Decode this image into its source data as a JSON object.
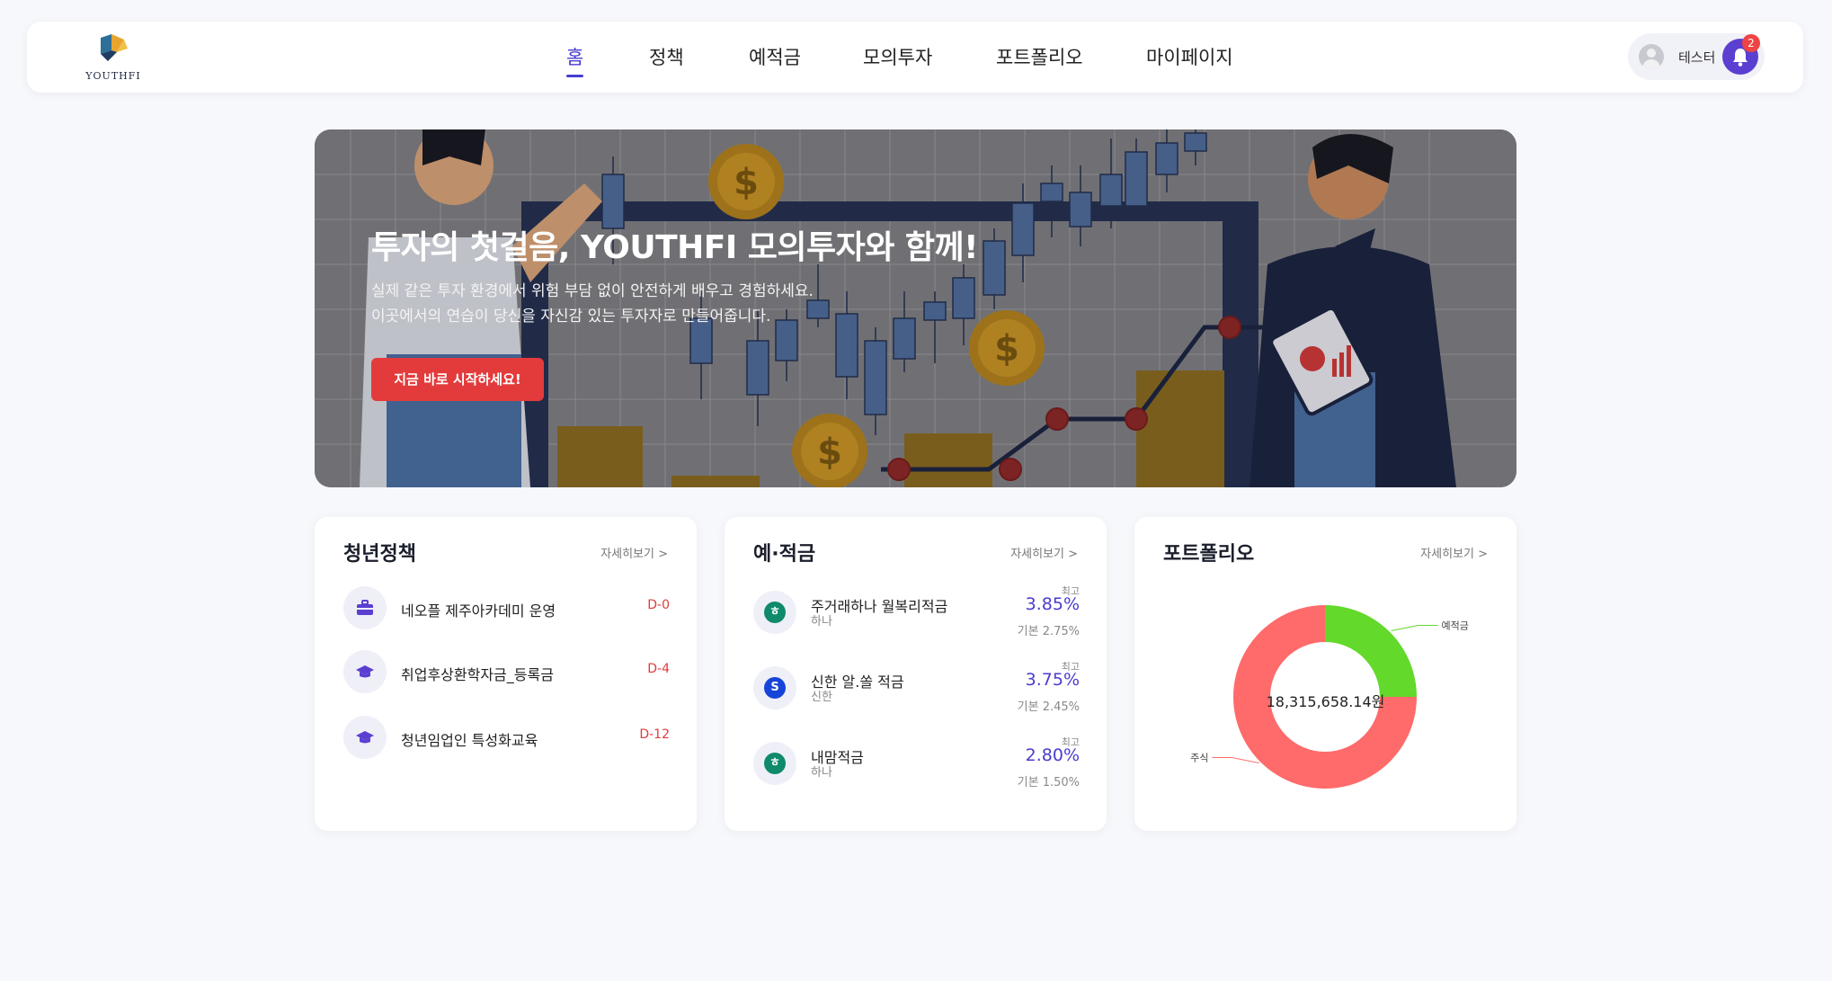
{
  "brand": {
    "logo_text": "YOUTHFI"
  },
  "nav": {
    "items": [
      "홈",
      "정책",
      "예적금",
      "모의투자",
      "포트폴리오",
      "마이페이지"
    ],
    "active_index": 0
  },
  "user": {
    "name": "테스터",
    "notification_count": "2"
  },
  "hero": {
    "title": "투자의 첫걸음, YOUTHFI 모의투자와 함께!",
    "subtitle_line1": "실제 같은 투자 환경에서 위험 부담 없이 안전하게 배우고 경험하세요.",
    "subtitle_line2": "이곳에서의 연습이 당신을 자신감 있는 투자자로 만들어줍니다.",
    "cta_label": "지금 바로 시작하세요!"
  },
  "policy_card": {
    "title": "청년정책",
    "more_label": "자세히보기 >",
    "items": [
      {
        "name": "네오플 제주아카데미 운영",
        "dday": "D-0",
        "icon": "briefcase-icon"
      },
      {
        "name": "취업후상환학자금_등록금",
        "dday": "D-4",
        "icon": "graduation-cap-icon"
      },
      {
        "name": "청년임업인 특성화교육",
        "dday": "D-12",
        "icon": "graduation-cap-icon"
      }
    ]
  },
  "savings_card": {
    "title": "예·적금",
    "more_label": "자세히보기 >",
    "items": [
      {
        "name": "주거래하나 월복리적금",
        "bank": "하나",
        "max_label": "최고",
        "rate": "3.85%",
        "base": "기본 2.75%",
        "icon_color": "#0f8a6b",
        "icon_glyph": "ㅎ"
      },
      {
        "name": "신한 알.쏠 적금",
        "bank": "신한",
        "max_label": "최고",
        "rate": "3.75%",
        "base": "기본 2.45%",
        "icon_color": "#1744d8",
        "icon_glyph": "S"
      },
      {
        "name": "내맘적금",
        "bank": "하나",
        "max_label": "최고",
        "rate": "2.80%",
        "base": "기본 1.50%",
        "icon_color": "#0f8a6b",
        "icon_glyph": "ㅎ"
      }
    ]
  },
  "portfolio_card": {
    "title": "포트폴리오",
    "more_label": "자세히보기 >",
    "total": "18,315,658.14원"
  },
  "chart_data": {
    "type": "pie",
    "donut": true,
    "categories": [
      "예적금",
      "주식"
    ],
    "values": [
      0.25,
      0.75
    ],
    "colors": [
      "#62d92b",
      "#ff6a6a"
    ],
    "center_text": "18,315,658.14원"
  }
}
